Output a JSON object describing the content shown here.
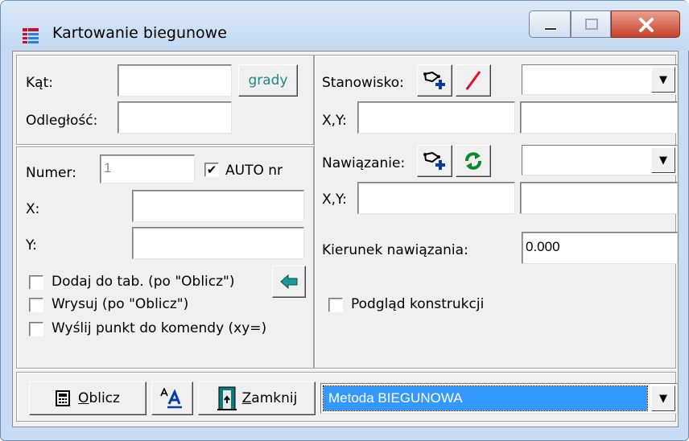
{
  "window": {
    "title": "Kartowanie biegunowe"
  },
  "left": {
    "kat": {
      "label": "Kąt:",
      "value": "",
      "unit_button": "grady"
    },
    "odleglosc": {
      "label": "Odległość:",
      "value": ""
    },
    "numer": {
      "label": "Numer:",
      "value": "1",
      "auto_label": "AUTO nr",
      "auto_checked": true
    },
    "x": {
      "label": "X:",
      "value": ""
    },
    "y": {
      "label": "Y:",
      "value": ""
    },
    "checks": [
      {
        "label": "Dodaj do tab. (po \"Oblicz\")",
        "checked": false
      },
      {
        "label": "Wrysuj (po \"Oblicz\")",
        "checked": false
      },
      {
        "label": "Wyślij punkt do komendy (xy=)",
        "checked": false
      }
    ]
  },
  "right": {
    "stanowisko": {
      "label": "Stanowisko:",
      "selected": ""
    },
    "stan_xy": {
      "label": "X,Y:",
      "x": "",
      "y": ""
    },
    "nawiazanie": {
      "label": "Nawiązanie:",
      "selected": ""
    },
    "naw_xy": {
      "label": "X,Y:",
      "x": "",
      "y": ""
    },
    "kierunek": {
      "label": "Kierunek nawiązania:",
      "value": "0.000"
    },
    "podglad": {
      "label": "Podgląd konstrukcji",
      "checked": false
    }
  },
  "footer": {
    "oblicz_first": "O",
    "oblicz_rest": "blicz",
    "zamknij_first": "Z",
    "zamknij_rest": "amknij",
    "method_selected": "Metoda BIEGUNOWA"
  }
}
